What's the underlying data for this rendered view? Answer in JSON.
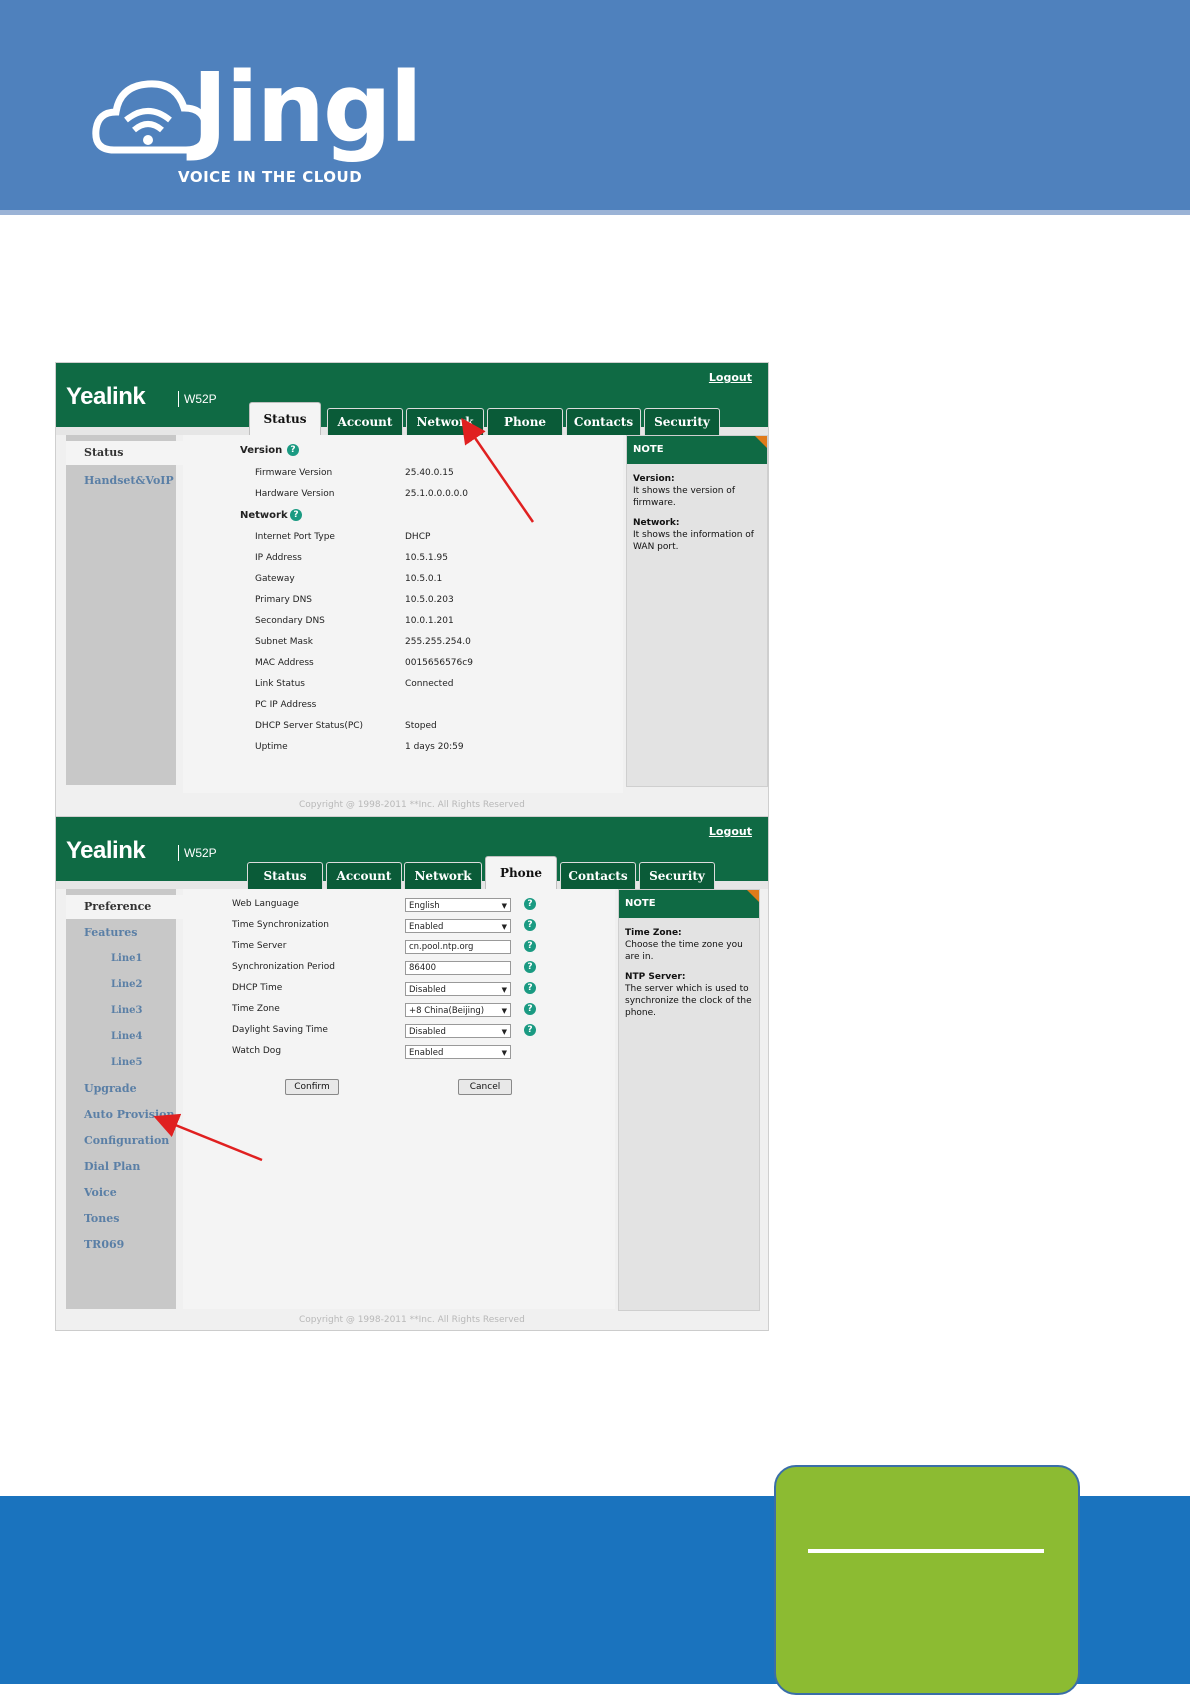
{
  "logo": {
    "word": "Jingl",
    "tagline": "VOICE IN THE CLOUD"
  },
  "panel1": {
    "brand": "Yealink",
    "model": "W52P",
    "logout": "Logout",
    "tabs": [
      "Status",
      "Account",
      "Network",
      "Phone",
      "Contacts",
      "Security"
    ],
    "active_tab": "Status",
    "sidebar": [
      "Status",
      "Handset&VoIP"
    ],
    "version_heading": "Version",
    "version_rows": [
      {
        "label": "Firmware Version",
        "value": "25.40.0.15"
      },
      {
        "label": "Hardware Version",
        "value": "25.1.0.0.0.0.0"
      }
    ],
    "network_heading": "Network",
    "network_rows": [
      {
        "label": "Internet Port Type",
        "value": "DHCP"
      },
      {
        "label": "IP Address",
        "value": "10.5.1.95"
      },
      {
        "label": "Gateway",
        "value": "10.5.0.1"
      },
      {
        "label": "Primary DNS",
        "value": "10.5.0.203"
      },
      {
        "label": "Secondary DNS",
        "value": "10.0.1.201"
      },
      {
        "label": "Subnet Mask",
        "value": "255.255.254.0"
      },
      {
        "label": "MAC Address",
        "value": "0015656576c9"
      },
      {
        "label": "Link Status",
        "value": "Connected"
      },
      {
        "label": "PC IP Address",
        "value": ""
      },
      {
        "label": "DHCP Server Status(PC)",
        "value": "Stoped"
      },
      {
        "label": "Uptime",
        "value": "1 days 20:59"
      }
    ],
    "note": {
      "title": "NOTE",
      "items": [
        {
          "term": "Version:",
          "text": "It shows the version of firmware."
        },
        {
          "term": "Network:",
          "text": "It shows the information of WAN port."
        }
      ]
    },
    "copyright": "Copyright @ 1998-2011 **Inc. All Rights Reserved"
  },
  "panel2": {
    "brand": "Yealink",
    "model": "W52P",
    "logout": "Logout",
    "tabs": [
      "Status",
      "Account",
      "Network",
      "Phone",
      "Contacts",
      "Security"
    ],
    "active_tab": "Phone",
    "sidebar": [
      {
        "label": "Preference",
        "sub": false
      },
      {
        "label": "Features",
        "sub": false
      },
      {
        "label": "Line1",
        "sub": true
      },
      {
        "label": "Line2",
        "sub": true
      },
      {
        "label": "Line3",
        "sub": true
      },
      {
        "label": "Line4",
        "sub": true
      },
      {
        "label": "Line5",
        "sub": true
      },
      {
        "label": "Upgrade",
        "sub": false
      },
      {
        "label": "Auto Provision",
        "sub": false
      },
      {
        "label": "Configuration",
        "sub": false
      },
      {
        "label": "Dial Plan",
        "sub": false
      },
      {
        "label": "Voice",
        "sub": false
      },
      {
        "label": "Tones",
        "sub": false
      },
      {
        "label": "TR069",
        "sub": false
      }
    ],
    "form": [
      {
        "label": "Web Language",
        "value": "English",
        "kind": "select",
        "help": true
      },
      {
        "label": "Time Synchronization",
        "value": "Enabled",
        "kind": "select",
        "help": true
      },
      {
        "label": "Time Server",
        "value": "cn.pool.ntp.org",
        "kind": "input",
        "help": true
      },
      {
        "label": "Synchronization Period",
        "value": "86400",
        "kind": "input",
        "help": true
      },
      {
        "label": "DHCP Time",
        "value": "Disabled",
        "kind": "select",
        "help": true
      },
      {
        "label": "Time Zone",
        "value": "+8 China(Beijing)",
        "kind": "select",
        "help": true
      },
      {
        "label": "Daylight Saving Time",
        "value": "Disabled",
        "kind": "select",
        "help": true
      },
      {
        "label": "Watch Dog",
        "value": "Enabled",
        "kind": "select",
        "help": false
      }
    ],
    "confirm": "Confirm",
    "cancel": "Cancel",
    "note": {
      "title": "NOTE",
      "items": [
        {
          "term": "Time Zone:",
          "text": "Choose the time zone you are in."
        },
        {
          "term": "NTP Server:",
          "text": "The server which is used to synchronize the clock of the phone."
        }
      ]
    },
    "copyright": "Copyright @ 1998-2011 **Inc. All Rights Reserved"
  },
  "colors": {
    "header_blue": "#4f81bd",
    "footer_blue": "#1a73be",
    "yealink_green": "#0f6a44",
    "accent_green": "#8cbb32",
    "arrow_red": "#e02020"
  }
}
